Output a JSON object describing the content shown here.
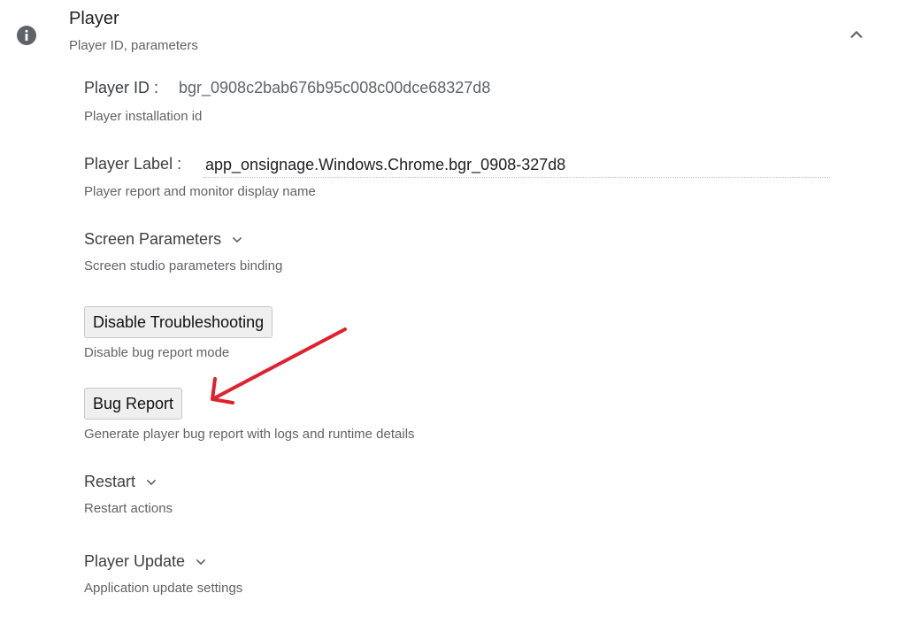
{
  "section": {
    "title": "Player",
    "subtitle": "Player ID, parameters",
    "info_icon": "info-icon",
    "collapse_icon": "chevron-up-icon"
  },
  "player_id": {
    "label": "Player ID :",
    "value": "bgr_0908c2bab676b95c008c00dce68327d8",
    "help": "Player installation id"
  },
  "player_label": {
    "label": "Player Label :",
    "value": "app_onsignage.Windows.Chrome.bgr_0908-327d8",
    "help": "Player report and monitor display name"
  },
  "screen_parameters": {
    "label": "Screen Parameters",
    "help": "Screen studio parameters binding",
    "icon": "chevron-down-icon"
  },
  "troubleshooting": {
    "button_label": "Disable Troubleshooting",
    "help": "Disable bug report mode"
  },
  "bug_report": {
    "button_label": "Bug Report",
    "help": "Generate player bug report with logs and runtime details"
  },
  "restart": {
    "label": "Restart",
    "help": "Restart actions",
    "icon": "chevron-down-icon"
  },
  "player_update": {
    "label": "Player Update",
    "help": "Application update settings",
    "icon": "chevron-down-icon"
  },
  "annotation": {
    "arrow_color": "#e0202e"
  }
}
